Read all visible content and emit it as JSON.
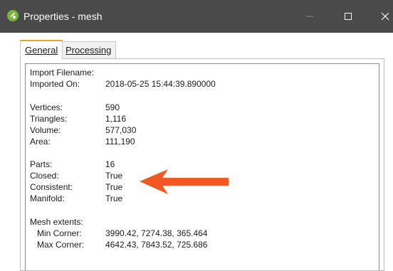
{
  "window": {
    "title": "Properties - mesh",
    "app_icon": "leapfrog-app-icon",
    "controls": {
      "minimize": "minimize-icon",
      "maximize": "maximize-icon",
      "close": "close-icon"
    }
  },
  "tabs": [
    {
      "label": "General",
      "active": true
    },
    {
      "label": "Processing",
      "active": false
    }
  ],
  "properties": [
    {
      "key": "Import Filename:",
      "value": ""
    },
    {
      "key": "Imported On:",
      "value": "2018-05-25 15:44:39.890000"
    },
    {
      "key": "Vertices:",
      "value": "590"
    },
    {
      "key": "Triangles:",
      "value": "1,116"
    },
    {
      "key": "Volume:",
      "value": "577,030"
    },
    {
      "key": "Area:",
      "value": "111,190"
    },
    {
      "key": "Parts:",
      "value": "16"
    },
    {
      "key": "Closed:",
      "value": "True"
    },
    {
      "key": "Consistent:",
      "value": "True"
    },
    {
      "key": "Manifold:",
      "value": "True"
    },
    {
      "key": "Mesh extents:",
      "value": ""
    },
    {
      "key": "Min Corner:",
      "value": "3990.42, 7274.38, 365.464"
    },
    {
      "key": "Max Corner:",
      "value": "4642.43, 7843.52, 725.686"
    }
  ],
  "annotation": {
    "type": "arrow",
    "color": "#f05a22",
    "points_to": "Closed: True"
  },
  "colors": {
    "titlebar": "#4a4a4a",
    "active_tab_accent": "#e8a33c",
    "arrow": "#f05a22"
  }
}
